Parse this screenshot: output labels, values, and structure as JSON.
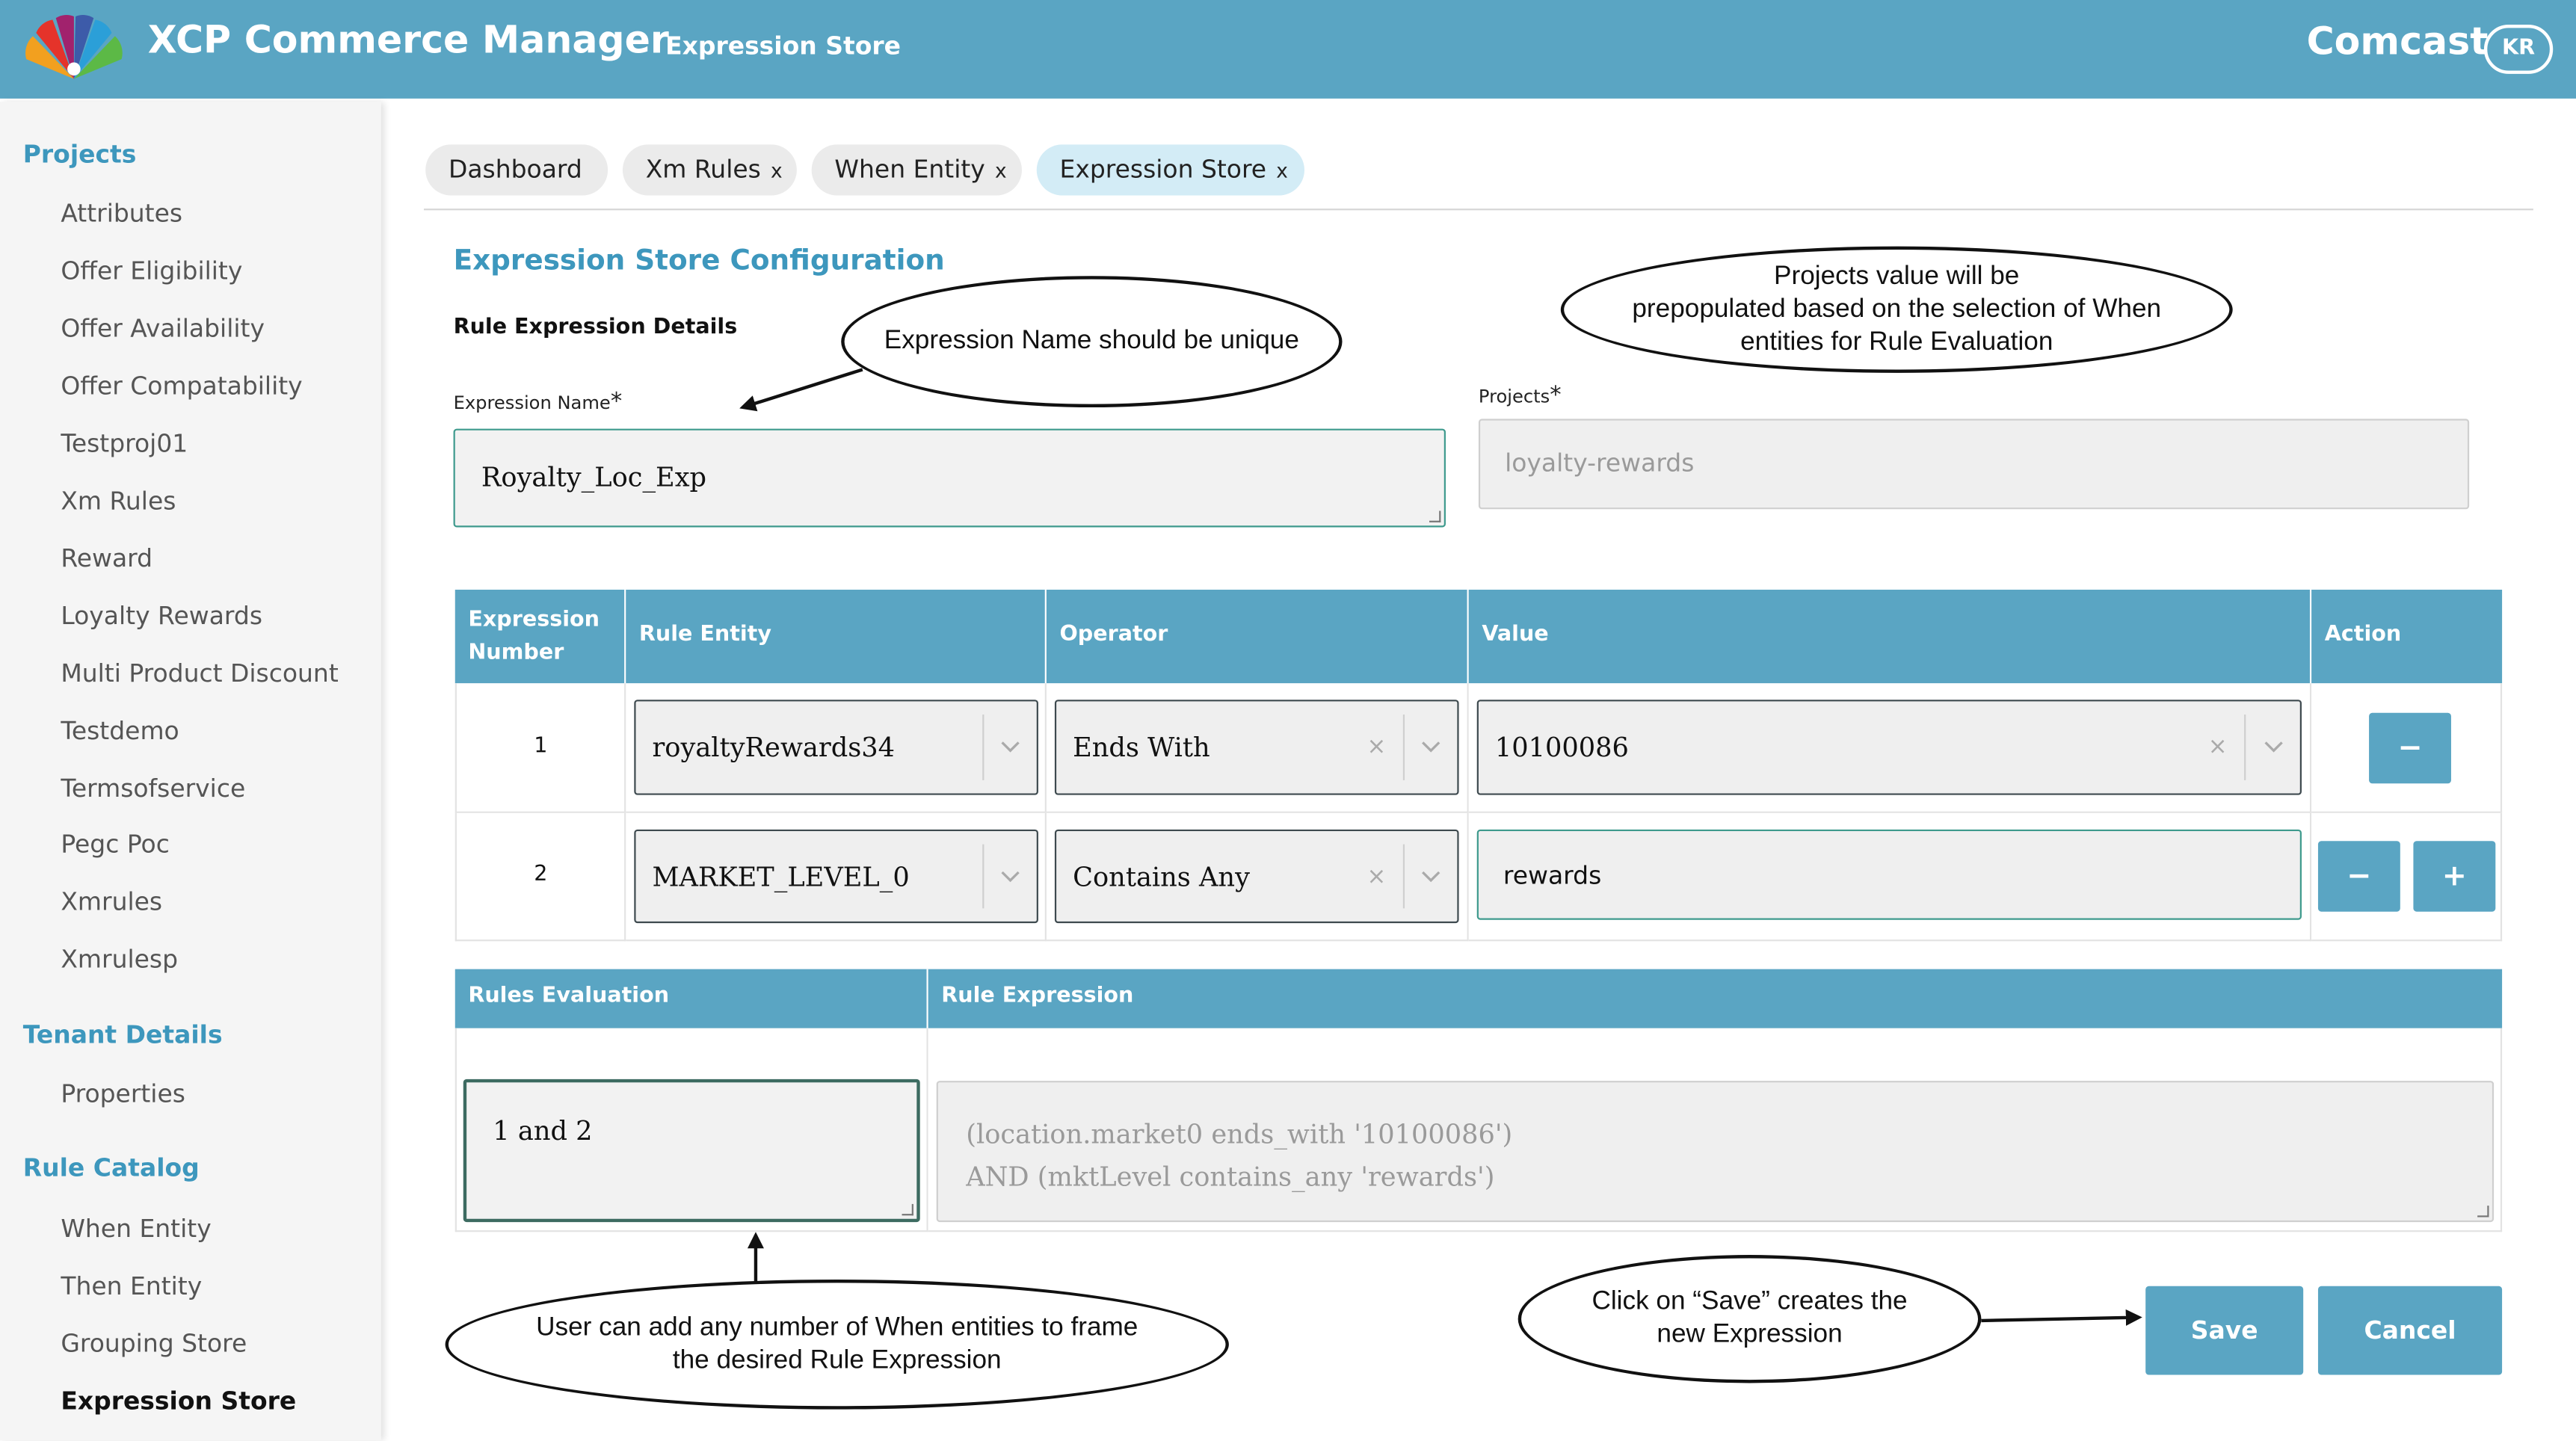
{
  "header": {
    "app_title": "XCP Commerce Manager",
    "nav_title": "Expression Store",
    "brand": "Comcast",
    "user_initials": "KR"
  },
  "sidebar": {
    "sections": [
      {
        "title": "Projects",
        "items": [
          "Attributes",
          "Offer Eligibility",
          "Offer Availability",
          "Offer Compatability",
          "Testproj01",
          "Xm Rules",
          "Reward",
          "Loyalty Rewards",
          "Multi Product Discount",
          "Testdemo",
          "Termsofservice",
          "Pegc Poc",
          "Xmrules",
          "Xmrulesp"
        ]
      },
      {
        "title": "Tenant Details",
        "items": [
          "Properties"
        ]
      },
      {
        "title": "Rule Catalog",
        "items": [
          "When Entity",
          "Then Entity",
          "Grouping Store",
          "Expression Store"
        ]
      }
    ],
    "active_item": "Expression Store"
  },
  "tabs": [
    {
      "label": "Dashboard",
      "closable": false
    },
    {
      "label": "Xm Rules",
      "closable": true
    },
    {
      "label": "When Entity",
      "closable": true
    },
    {
      "label": "Expression Store",
      "closable": true,
      "active": true
    }
  ],
  "tab_close_glyph": "x",
  "form": {
    "section_title": "Expression Store Configuration",
    "subheading": "Rule Expression Details",
    "required_mark": "*",
    "expression_name": {
      "label": "Expression Name",
      "value": "Royalty_Loc_Exp"
    },
    "projects": {
      "label": "Projects",
      "placeholder": "loyalty-rewards"
    }
  },
  "table": {
    "headers": [
      "Expression Number",
      "Rule Entity",
      "Operator",
      "Value",
      "Action"
    ],
    "rows": [
      {
        "number": "1",
        "rule_entity": "royaltyRewards34",
        "operator": "Ends With",
        "value": "10100086"
      },
      {
        "number": "2",
        "rule_entity": "MARKET_LEVEL_0",
        "operator": "Contains Any",
        "value": "rewards"
      }
    ],
    "remove_glyph": "−",
    "add_glyph": "+"
  },
  "evaluation": {
    "headers": [
      "Rules Evaluation",
      "Rule Expression"
    ],
    "rules_evaluation": "1 and 2",
    "rule_expression": [
      "(location.market0 ends_with '10100086')",
      "AND (mktLevel contains_any 'rewards')"
    ]
  },
  "buttons": {
    "save": "Save",
    "cancel": "Cancel"
  },
  "callouts": {
    "name_unique": "Expression Name should be unique",
    "projects_prepopulated": [
      "Projects value will be",
      "prepopulated based on the selection of When",
      "entities for Rule Evaluation"
    ],
    "when_entities": [
      "User can add any number of When entities to frame",
      "the desired Rule Expression"
    ],
    "save_creates": [
      "Click on “Save” creates the",
      "new Expression"
    ]
  },
  "colors": {
    "header": "#5aa5c3",
    "accent": "#3d97bd",
    "active_tab": "#d3ecf6"
  }
}
